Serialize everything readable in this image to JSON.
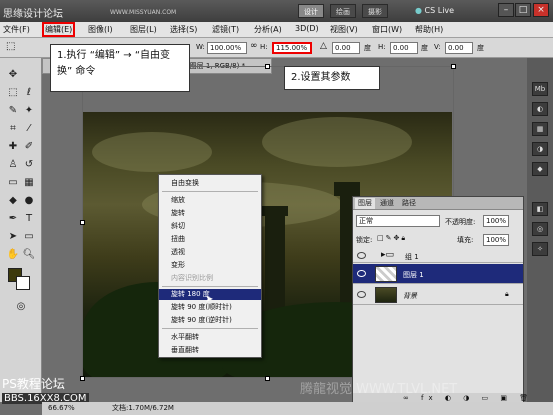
{
  "topbar": {
    "site_title": "思缘设计论坛",
    "site_url": "WWW.MISSYUAN.COM",
    "workspaces": [
      "设计",
      "绘画",
      "摄影"
    ],
    "cslive": "CS Live"
  },
  "menu": [
    "文件(F)",
    "编辑(E)",
    "图像(I)",
    "图层(L)",
    "选择(S)",
    "滤镜(T)",
    "分析(A)",
    "3D(D)",
    "视图(V)",
    "窗口(W)",
    "帮助(H)"
  ],
  "options": {
    "w_label": "W:",
    "w_value": "100.00%",
    "h_label": "H:",
    "h_value": "115.00%",
    "angle_value": "0.00",
    "deg": "度",
    "hskew_label": "H:",
    "hskew_value": "0.00",
    "vskew_label": "V:",
    "vskew_value": "0.00"
  },
  "doc_tab": "% (图层 1, RGB/8) *",
  "context_menu": [
    "自由变换",
    "缩放",
    "旋转",
    "斜切",
    "扭曲",
    "透视",
    "变形",
    "内容识别比例",
    "旋转 180 度",
    "旋转 90 度(顺时针)",
    "旋转 90 度(逆时针)",
    "水平翻转",
    "垂直翻转"
  ],
  "callouts": {
    "step1": "1.执行 “编辑” → “自由变换” 命令",
    "step2": "2.设置其参数"
  },
  "layers_panel": {
    "tabs": [
      "图层",
      "通道",
      "路径"
    ],
    "blend_mode": "正常",
    "opacity_label": "不透明度:",
    "opacity": "100%",
    "lock_label": "锁定:",
    "fill_label": "填充:",
    "fill": "100%",
    "layers": [
      {
        "name": "组 1",
        "selected": false
      },
      {
        "name": "图层 1",
        "selected": true
      },
      {
        "name": "背景",
        "selected": false
      }
    ]
  },
  "status": {
    "zoom": "66.67%",
    "doc": "文档:1.70M/6.72M"
  },
  "watermarks": {
    "ps_forum": "PS教程论坛",
    "bbs": "BBS.16XX8.COM",
    "tlvl": "腾龍视觉 WWW.TLVL.NET"
  },
  "colors": {
    "foreground": "#3d3a0c",
    "background": "#ffffff",
    "selection": "#1e2a7a",
    "highlight": "#e00000"
  }
}
